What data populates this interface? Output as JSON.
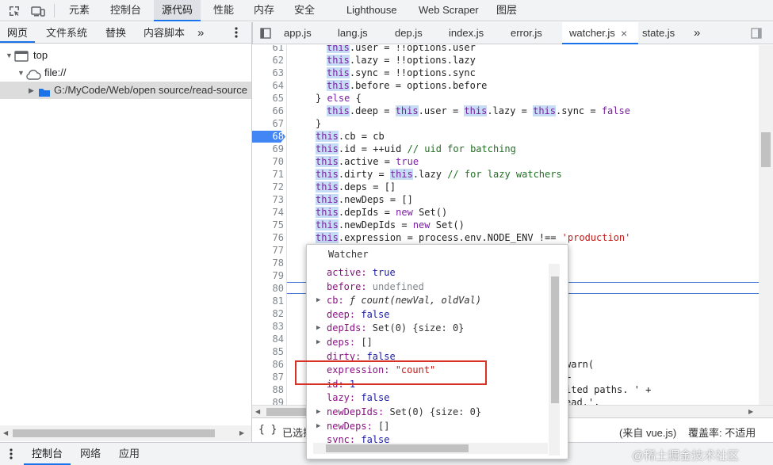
{
  "top_tabs": [
    "元素",
    "控制台",
    "源代码",
    "性能",
    "内存",
    "安全",
    "Lighthouse",
    "Web Scraper",
    "图层"
  ],
  "top_selected": "源代码",
  "nav_tabs": [
    "网页",
    "文件系统",
    "替换",
    "内容脚本"
  ],
  "nav_more": "»",
  "tree": {
    "top": "top",
    "file": "file://",
    "folder": "G:/MyCode/Web/open source/read-source"
  },
  "file_tabs": [
    "app.js",
    "lang.js",
    "dep.js",
    "index.js",
    "error.js",
    "watcher.js",
    "state.js"
  ],
  "file_selected": "watcher.js",
  "file_more": "»",
  "close_glyph": "×",
  "code_lines": [
    {
      "n": "61",
      "t": "this.user = !!options.user"
    },
    {
      "n": "62",
      "t": "this.lazy = !!options.lazy"
    },
    {
      "n": "63",
      "t": "this.sync = !!options.sync"
    },
    {
      "n": "64",
      "t": "this.before = options.before"
    },
    {
      "n": "65",
      "t": "} else {"
    },
    {
      "n": "66",
      "t": "this.deep = this.user = this.lazy = this.sync = false"
    },
    {
      "n": "67",
      "t": "}"
    },
    {
      "n": "68",
      "t": "this.cb = cb"
    },
    {
      "n": "69",
      "t": "this.id = ++uid // uid for batching"
    },
    {
      "n": "70",
      "t": "this.active = true"
    },
    {
      "n": "71",
      "t": "this.dirty = this.lazy // for lazy watchers"
    },
    {
      "n": "72",
      "t": "this.deps = []"
    },
    {
      "n": "73",
      "t": "this.newDeps = []"
    },
    {
      "n": "74",
      "t": "this.depIds = new Set()"
    },
    {
      "n": "75",
      "t": "this.newDepIds = new Set()"
    },
    {
      "n": "76",
      "t": "this.expression = process.env.NODE_ENV !== 'production'"
    },
    {
      "n": "77",
      "t": ""
    },
    {
      "n": "78",
      "t": ""
    },
    {
      "n": "79",
      "t": ""
    },
    {
      "n": "80",
      "t": ""
    },
    {
      "n": "81",
      "t": ""
    },
    {
      "n": "82",
      "t": ""
    },
    {
      "n": "83",
      "t": ""
    },
    {
      "n": "84",
      "t": ""
    },
    {
      "n": "85",
      "t": ""
    },
    {
      "n": "86",
      "t": "warn("
    },
    {
      "n": "87",
      "t": "+"
    },
    {
      "n": "88",
      "t": "ited paths. ' +"
    },
    {
      "n": "89",
      "t": "ead.',"
    }
  ],
  "breakpoint_line": "68",
  "popover": {
    "title": "Watcher",
    "rows": [
      {
        "k": "active",
        "v": "true",
        "exp": false
      },
      {
        "k": "before",
        "v": "undefined",
        "exp": false
      },
      {
        "k": "cb",
        "v": "ƒ count(newVal, oldVal)",
        "exp": true
      },
      {
        "k": "deep",
        "v": "false",
        "exp": false
      },
      {
        "k": "depIds",
        "v": "Set(0) {size: 0}",
        "exp": true
      },
      {
        "k": "deps",
        "v": "[]",
        "exp": true
      },
      {
        "k": "dirty",
        "v": "false",
        "exp": false
      },
      {
        "k": "expression",
        "v": "\"count\"",
        "exp": false
      },
      {
        "k": "id",
        "v": "1",
        "exp": false
      },
      {
        "k": "lazy",
        "v": "false",
        "exp": false
      },
      {
        "k": "newDepIds",
        "v": "Set(0) {size: 0}",
        "exp": true
      },
      {
        "k": "newDeps",
        "v": "[]",
        "exp": true
      },
      {
        "k": "sync",
        "v": "false",
        "exp": false
      }
    ]
  },
  "status": {
    "braces": "{ }",
    "selected": "已选择",
    "source": "(来自 vue.js)",
    "coverage": "覆盖率: 不适用"
  },
  "drawer_tabs": [
    "控制台",
    "网络",
    "应用"
  ],
  "drawer_selected": "控制台",
  "watermark": "@稀土掘金技术社区"
}
